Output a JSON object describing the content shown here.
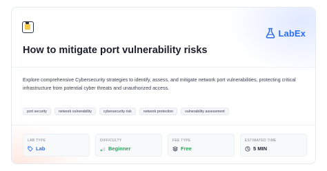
{
  "brand": {
    "name": "LabEx",
    "color": "#2b6de8",
    "icon": "flask-icon"
  },
  "header": {
    "icon": "lab-icon"
  },
  "title": "How to mitigate port vulnerability risks",
  "description": "Explore comprehensive Cybersecurity strategies to identify, assess, and mitigate network port vulnerabilities, protecting critical infrastructure from potential cyber threats and unauthorized access.",
  "tags": [
    "port security",
    "network vulnerability",
    "cybersecurity risk",
    "network protection",
    "vulnerability assessment"
  ],
  "meta": [
    {
      "label": "LAB TYPE",
      "value": "Lab",
      "icon": "tag-icon",
      "color": "#2b6de8"
    },
    {
      "label": "DIFFICULTY",
      "value": "Beginner",
      "icon": "difficulty-bars-icon",
      "color": "#27a35a"
    },
    {
      "label": "FEE TYPE",
      "value": "Free",
      "icon": "layers-icon",
      "color": "#27a35a"
    },
    {
      "label": "ESTIMATED TIME",
      "value": "5 MIN",
      "icon": "clock-icon",
      "color": "#1f2430"
    }
  ]
}
